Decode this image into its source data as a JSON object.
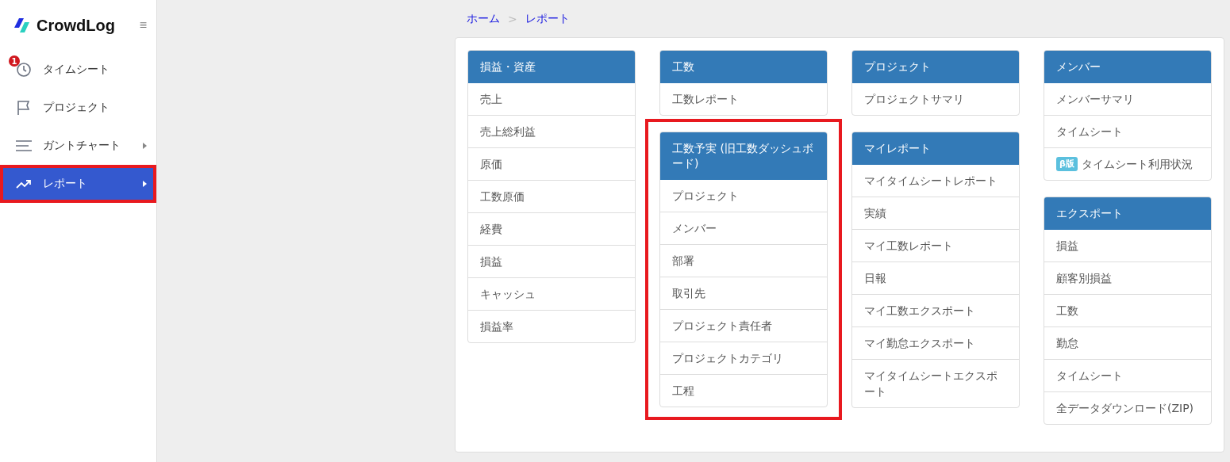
{
  "sidebar": {
    "logo": "CrowdLog",
    "menu_icon": "≡",
    "items": [
      {
        "label": "タイムシート",
        "badge": "1",
        "has_submenu": false,
        "selected": false,
        "highlighted": false
      },
      {
        "label": "プロジェクト",
        "has_submenu": false,
        "selected": false,
        "highlighted": false
      },
      {
        "label": "ガントチャート",
        "has_submenu": true,
        "selected": false,
        "highlighted": false
      },
      {
        "label": "レポート",
        "has_submenu": true,
        "selected": true,
        "highlighted": true
      }
    ]
  },
  "breadcrumb": {
    "items": [
      "ホーム",
      "レポート"
    ],
    "separator": ">"
  },
  "columns": [
    {
      "panels": [
        {
          "title": "損益・資産",
          "highlighted": false,
          "items": [
            {
              "label": "売上"
            },
            {
              "label": "売上総利益"
            },
            {
              "label": "原価"
            },
            {
              "label": "工数原価"
            },
            {
              "label": "経費"
            },
            {
              "label": "損益"
            },
            {
              "label": "キャッシュ"
            },
            {
              "label": "損益率"
            }
          ]
        }
      ]
    },
    {
      "panels": [
        {
          "title": "工数",
          "highlighted": false,
          "items": [
            {
              "label": "工数レポート"
            }
          ]
        },
        {
          "title": "工数予実 (旧工数ダッシュボード)",
          "highlighted": true,
          "items": [
            {
              "label": "プロジェクト"
            },
            {
              "label": "メンバー"
            },
            {
              "label": "部署"
            },
            {
              "label": "取引先"
            },
            {
              "label": "プロジェクト責任者"
            },
            {
              "label": "プロジェクトカテゴリ"
            },
            {
              "label": "工程"
            }
          ]
        }
      ]
    },
    {
      "panels": [
        {
          "title": "プロジェクト",
          "highlighted": false,
          "items": [
            {
              "label": "プロジェクトサマリ"
            }
          ]
        },
        {
          "title": "マイレポート",
          "highlighted": false,
          "items": [
            {
              "label": "マイタイムシートレポート"
            },
            {
              "label": "実績"
            },
            {
              "label": "マイ工数レポート"
            },
            {
              "label": "日報"
            },
            {
              "label": "マイ工数エクスポート"
            },
            {
              "label": "マイ勤怠エクスポート"
            },
            {
              "label": "マイタイムシートエクスポート"
            }
          ]
        }
      ]
    },
    {
      "panels": [
        {
          "title": "メンバー",
          "highlighted": false,
          "items": [
            {
              "label": "メンバーサマリ"
            },
            {
              "label": "タイムシート"
            },
            {
              "label": "タイムシート利用状況",
              "tag": "β版"
            }
          ]
        },
        {
          "title": "エクスポート",
          "highlighted": false,
          "items": [
            {
              "label": "損益"
            },
            {
              "label": "顧客別損益"
            },
            {
              "label": "工数"
            },
            {
              "label": "勤怠"
            },
            {
              "label": "タイムシート"
            },
            {
              "label": "全データダウンロード(ZIP)"
            }
          ]
        }
      ]
    }
  ]
}
